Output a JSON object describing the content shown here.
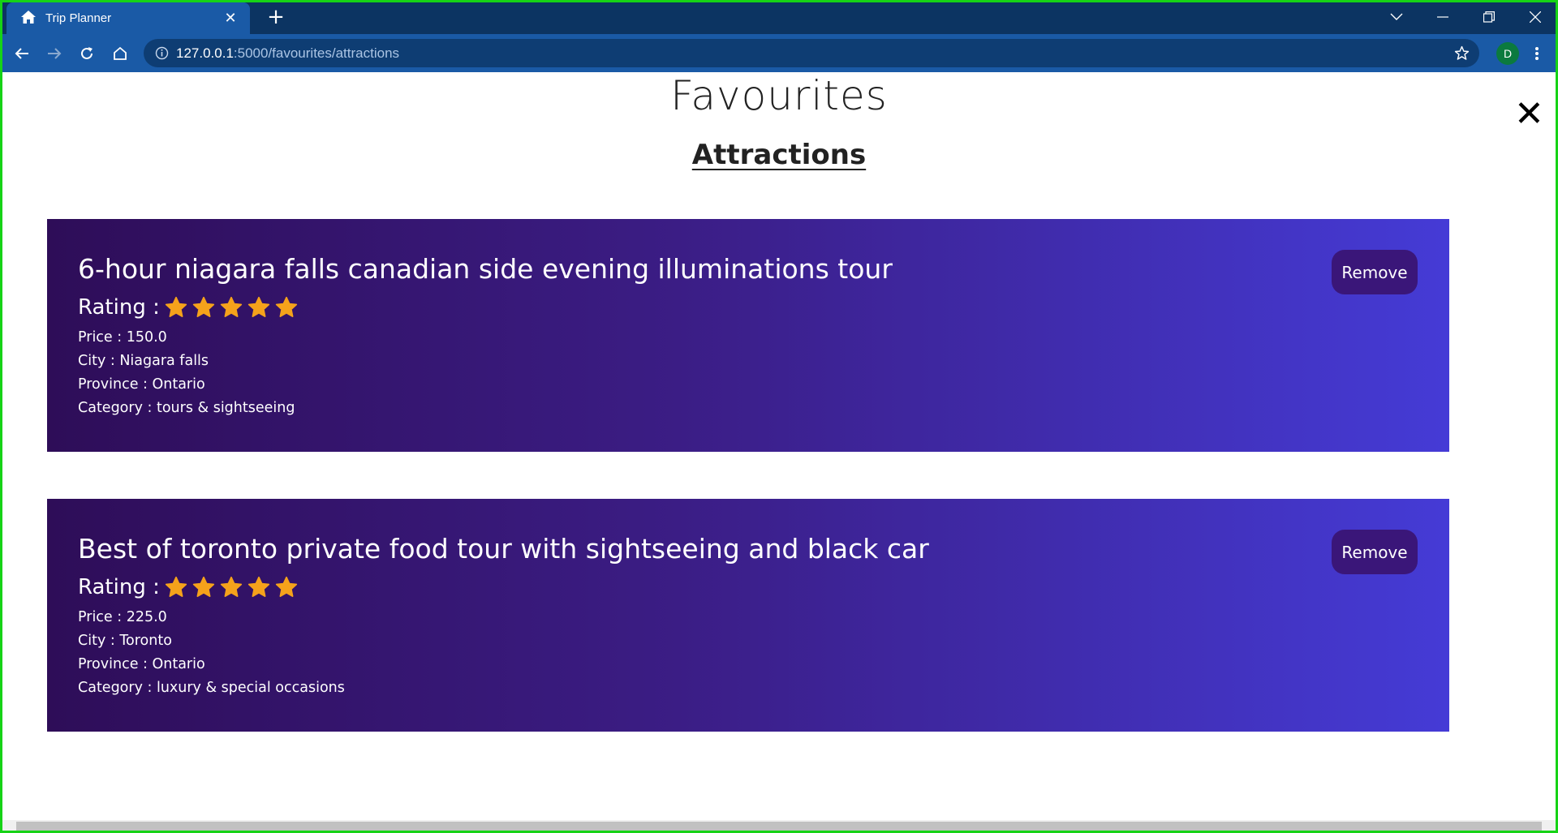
{
  "browser": {
    "tab_title": "Trip Planner",
    "url_host": "127.0.0.1",
    "url_path": ":5000/favourites/attractions",
    "profile_initial": "D"
  },
  "page": {
    "title": "Favourites",
    "subtitle": "Attractions",
    "close_symbol": "✕"
  },
  "attractions": [
    {
      "name": "6-hour niagara falls canadian side evening illuminations tour",
      "rating_label": "Rating :",
      "rating": 5,
      "price": "Price : 150.0",
      "city": "City : Niagara falls",
      "province": "Province : Ontario",
      "category": "Category : tours & sightseeing",
      "remove_label": "Remove"
    },
    {
      "name": "Best of toronto private food tour with sightseeing and black car",
      "rating_label": "Rating :",
      "rating": 5,
      "price": "Price : 225.0",
      "city": "City : Toronto",
      "province": "Province : Ontario",
      "category": "Category : luxury & special occasions",
      "remove_label": "Remove"
    }
  ],
  "colors": {
    "star": "#f5a21b",
    "card_start": "#2e0d58",
    "card_end": "#453bd6",
    "remove_button": "#3a1679"
  }
}
